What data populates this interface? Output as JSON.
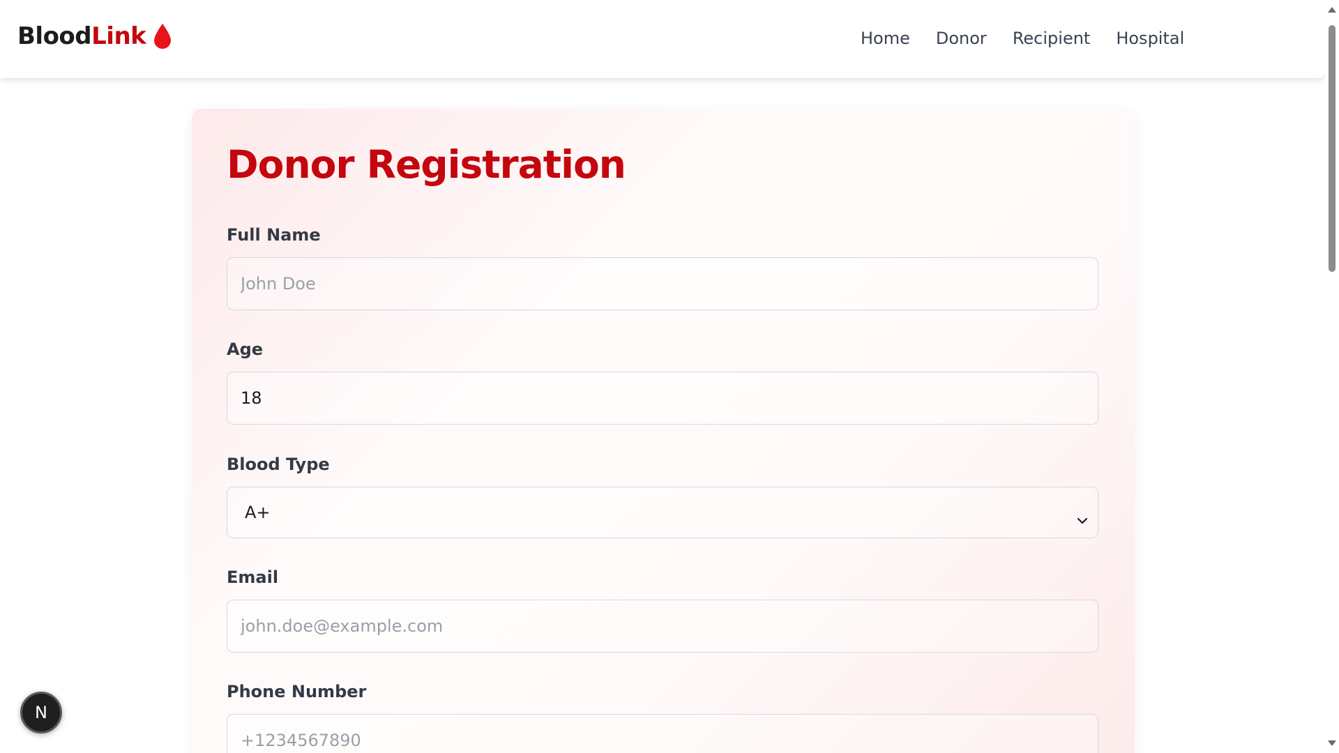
{
  "brand": {
    "part1": "Blood",
    "part2": "Link",
    "icon": "blood-drop-icon",
    "accent_color": "#c4060f"
  },
  "nav": {
    "items": [
      "Home",
      "Donor",
      "Recipient",
      "Hospital"
    ]
  },
  "form": {
    "title": "Donor Registration",
    "fields": [
      {
        "label": "Full Name",
        "placeholder": "John Doe",
        "value": ""
      },
      {
        "label": "Age",
        "placeholder": "",
        "value": "18"
      },
      {
        "label": "Blood Type",
        "value": "A+"
      },
      {
        "label": "Email",
        "placeholder": "john.doe@example.com",
        "value": ""
      },
      {
        "label": "Phone Number",
        "placeholder": "+1234567890",
        "value": ""
      }
    ]
  },
  "badge": {
    "letter": "N"
  }
}
